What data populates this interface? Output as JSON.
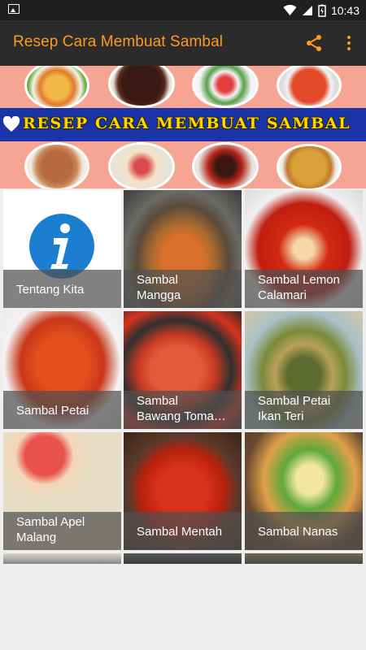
{
  "status_bar": {
    "time": "10:43"
  },
  "app_bar": {
    "title": "Resep Cara Membuat Sambal",
    "actions": [
      "share-icon",
      "more-vert-icon"
    ]
  },
  "banner": {
    "text": "RESEP CARA MEMBUAT SAMBAL"
  },
  "grid": {
    "tiles": [
      {
        "label": "Tentang Kita",
        "icon": "info-icon"
      },
      {
        "label": "Sambal\nMangga"
      },
      {
        "label": "Sambal Lemon\nCalamari"
      },
      {
        "label": "Sambal Petai"
      },
      {
        "label": "Sambal\nBawang Toma…"
      },
      {
        "label": "Sambal Petai\nIkan Teri"
      },
      {
        "label": "Sambal Apel\nMalang"
      },
      {
        "label": "Sambal Mentah"
      },
      {
        "label": "Sambal Nanas"
      }
    ]
  },
  "colors": {
    "app_bar": "#2b2b2b",
    "title": "#ff9a1f",
    "banner_bg": "#f6a493",
    "banner_strip": "#1a33a8",
    "banner_text": "#ffd400"
  }
}
